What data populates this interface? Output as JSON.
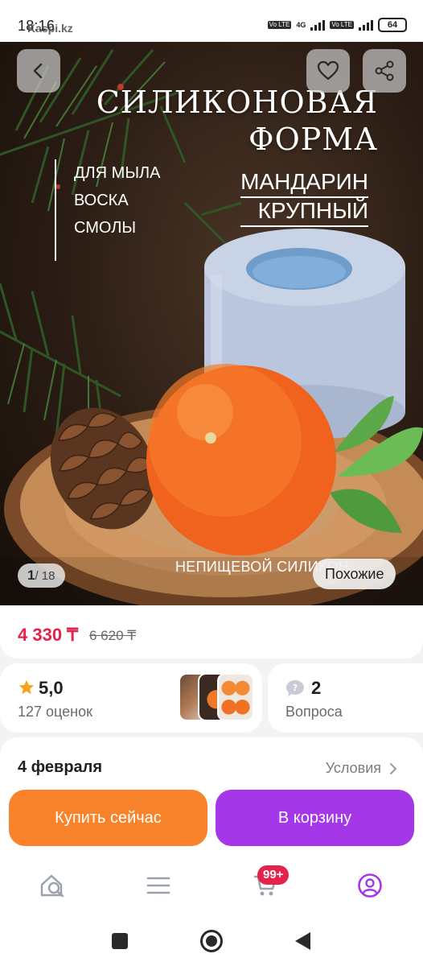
{
  "status_bar": {
    "time": "18:16",
    "url_watermark": "Kaspi.kz",
    "network_tag_1": "Vo LTE",
    "network_type": "4G",
    "network_tag_2": "Vo LTE",
    "battery": "64"
  },
  "hero": {
    "title_line1": "СИЛИКОНОВАЯ",
    "title_line2": "ФОРМА",
    "uses": [
      "ДЛЯ МЫЛА",
      "ВОСКА",
      "СМОЛЫ"
    ],
    "subtitle_line1": "МАНДАРИН",
    "subtitle_line2": "КРУПНЫЙ",
    "note": "НЕПИЩЕВОЙ СИЛИКОН",
    "pager_current": "1",
    "pager_total": "/ 18",
    "similar_label": "Похожие",
    "icons": {
      "back": "chevron-left-icon",
      "favorite": "heart-icon",
      "share": "share-icon"
    }
  },
  "price": {
    "current": "4 330 ₸",
    "old": "6 620 ₸",
    "current_color": "#e4224b"
  },
  "rating": {
    "value": "5,0",
    "count_label": "127 оценок",
    "star_color": "#f6a21e"
  },
  "questions": {
    "count": "2",
    "label": "Вопроса"
  },
  "delivery": {
    "date": "4 февраля",
    "terms_label": "Условия"
  },
  "actions": {
    "buy_now": "Купить сейчас",
    "add_to_cart": "В корзину",
    "buy_color": "#f8832a",
    "cart_color": "#a437e8"
  },
  "bottom_nav": {
    "items": [
      "home-search-icon",
      "catalog-menu-icon",
      "cart-icon",
      "profile-icon"
    ],
    "cart_badge": "99+",
    "active_color": "#a437e8"
  }
}
